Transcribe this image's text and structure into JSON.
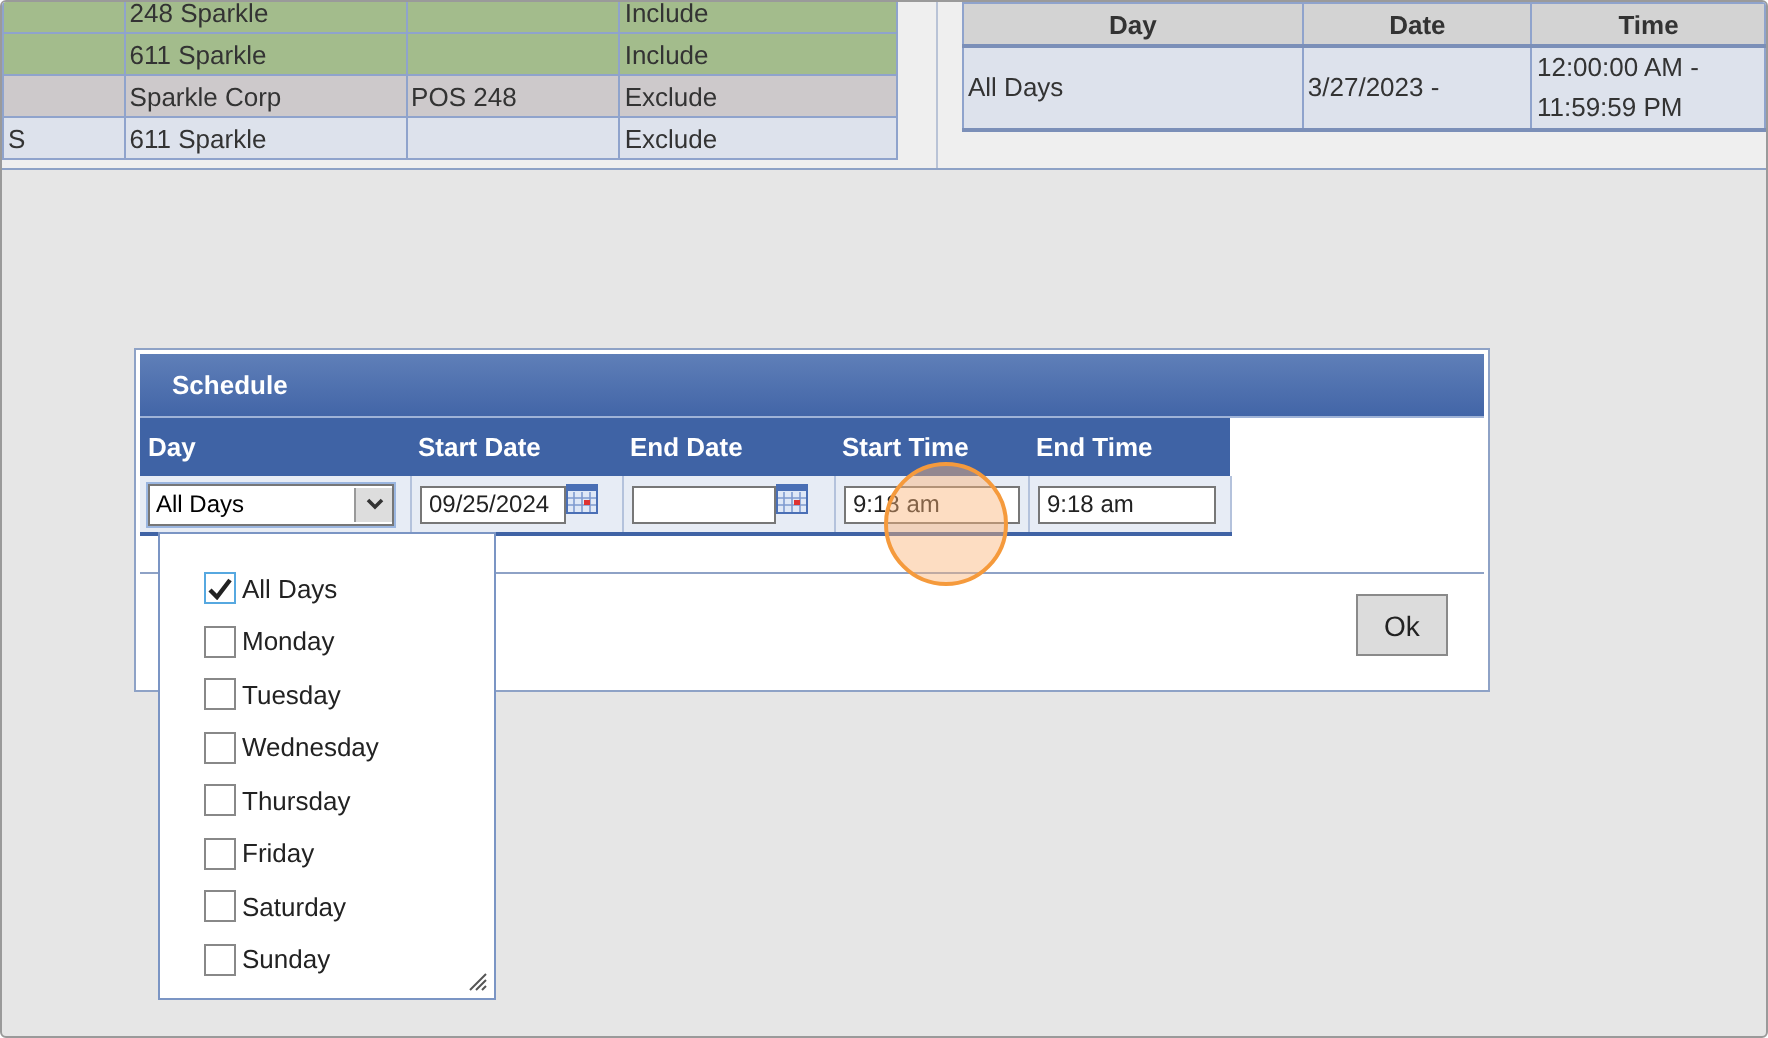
{
  "rules_table": {
    "rows": [
      {
        "cells": [
          "",
          "248 Sparkle",
          "",
          "Include"
        ],
        "color": "#a3bc8c"
      },
      {
        "cells": [
          "",
          "611 Sparkle",
          "",
          "Include"
        ],
        "color": "#a3bc8c"
      },
      {
        "cells": [
          "",
          "Sparkle Corp",
          "POS 248",
          "Exclude"
        ],
        "color": "#cdc9cb"
      },
      {
        "cells": [
          "S",
          "611 Sparkle",
          "",
          "Exclude"
        ],
        "color": "#dde2ec"
      }
    ]
  },
  "schedule_table": {
    "columns": [
      "Day",
      "Date",
      "Time"
    ],
    "rows": [
      {
        "cells": [
          "All Days",
          "3/27/2023 -",
          "12:00:00 AM - 11:59:59 PM"
        ]
      }
    ]
  },
  "dialog": {
    "title": "Schedule",
    "columns": [
      "Day",
      "Start Date",
      "End Date",
      "Start Time",
      "End Time"
    ],
    "day": {
      "value": "All Days",
      "expanded": true
    },
    "start_date": {
      "value": "09/25/2024"
    },
    "start_time": {
      "value": "9:18 am"
    },
    "end_time": {
      "value": "9:18 am"
    },
    "day_options": [
      {
        "label": "All Days",
        "checked": true
      },
      {
        "label": "Monday",
        "checked": false
      },
      {
        "label": "Tuesday",
        "checked": false
      },
      {
        "label": "Wednesday",
        "checked": false
      },
      {
        "label": "Thursday",
        "checked": false
      },
      {
        "label": "Friday",
        "checked": false
      },
      {
        "label": "Saturday",
        "checked": false
      },
      {
        "label": "Sunday",
        "checked": false
      }
    ],
    "ok_button": "Ok"
  },
  "click_marker": {
    "on": true
  }
}
